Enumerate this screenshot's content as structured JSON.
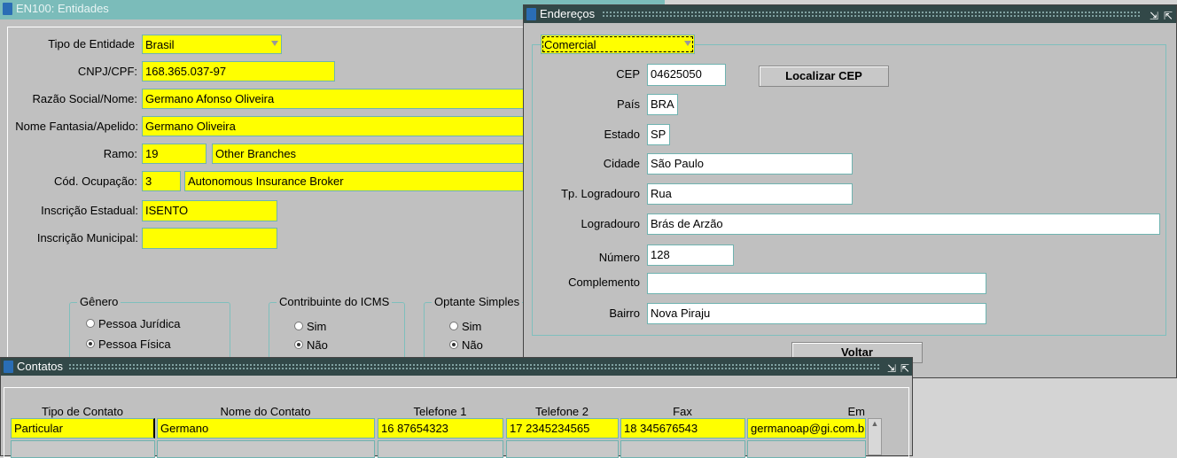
{
  "main": {
    "title": "EN100: Entidades",
    "tipo_entidade": {
      "label": "Tipo de Entidade",
      "value": "Brasil"
    },
    "cnpj": {
      "label": "CNPJ/CPF:",
      "value": "168.365.037-97"
    },
    "razao": {
      "label": "Razão Social/Nome:",
      "value": "Germano Afonso Oliveira"
    },
    "fantasia": {
      "label": "Nome Fantasia/Apelido:",
      "value": "Germano Oliveira"
    },
    "ramo": {
      "label": "Ramo:",
      "code": "19",
      "desc": "Other Branches"
    },
    "ocupacao": {
      "label": "Cód. Ocupação:",
      "code": "3",
      "desc": "Autonomous Insurance Broker"
    },
    "ie": {
      "label": "Inscrição Estadual:",
      "value": "ISENTO"
    },
    "im": {
      "label": "Inscrição Municipal:",
      "value": ""
    },
    "genero": {
      "label": "Gênero",
      "opt1": "Pessoa Jurídica",
      "opt2": "Pessoa Física",
      "selected": "Pessoa Física"
    },
    "icms": {
      "label": "Contribuinte do ICMS",
      "opt1": "Sim",
      "opt2": "Não",
      "selected": "Não"
    },
    "simples": {
      "label": "Optante Simples",
      "opt1": "Sim",
      "opt2": "Não",
      "selected": "Não"
    }
  },
  "enderecos": {
    "title": "Endereços",
    "tipo": "Comercial",
    "cep": {
      "label": "CEP",
      "value": "04625050"
    },
    "localizar": "Localizar CEP",
    "pais": {
      "label": "País",
      "value": "BRA"
    },
    "estado": {
      "label": "Estado",
      "value": "SP"
    },
    "cidade": {
      "label": "Cidade",
      "value": "São Paulo"
    },
    "tp_log": {
      "label": "Tp. Logradouro",
      "value": "Rua"
    },
    "logradouro": {
      "label": "Logradouro",
      "value": "Brás de Arzão"
    },
    "numero": {
      "label": "Número",
      "value": "128"
    },
    "complemento": {
      "label": "Complemento",
      "value": ""
    },
    "bairro": {
      "label": "Bairro",
      "value": "Nova Piraju"
    },
    "voltar": "Voltar"
  },
  "contatos": {
    "title": "Contatos",
    "headers": [
      "Tipo de Contato",
      "Nome do Contato",
      "Telefone 1",
      "Telefone 2",
      "Fax",
      "Em"
    ],
    "rows": [
      [
        "Particular",
        "Germano",
        "16 87654323",
        "17 2345234565",
        "18 345676543",
        "germanoap@gi.com.br"
      ]
    ]
  }
}
